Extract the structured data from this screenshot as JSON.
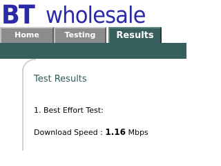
{
  "brand": {
    "bt": "BT",
    "wholesale": "wholesale",
    "color": "#2b2aa7"
  },
  "tabs": [
    {
      "label": "Home",
      "active": false
    },
    {
      "label": "Testing",
      "active": false
    },
    {
      "label": "Results",
      "active": true
    }
  ],
  "theme": {
    "accent": "#365f5d",
    "inactive_tab": "#8c8c8c"
  },
  "results": {
    "title": "Test Results",
    "test_name": "1. Best Effort Test:",
    "download_label": "Download Speed :",
    "download_value": "1.16",
    "download_unit": "Mbps"
  }
}
